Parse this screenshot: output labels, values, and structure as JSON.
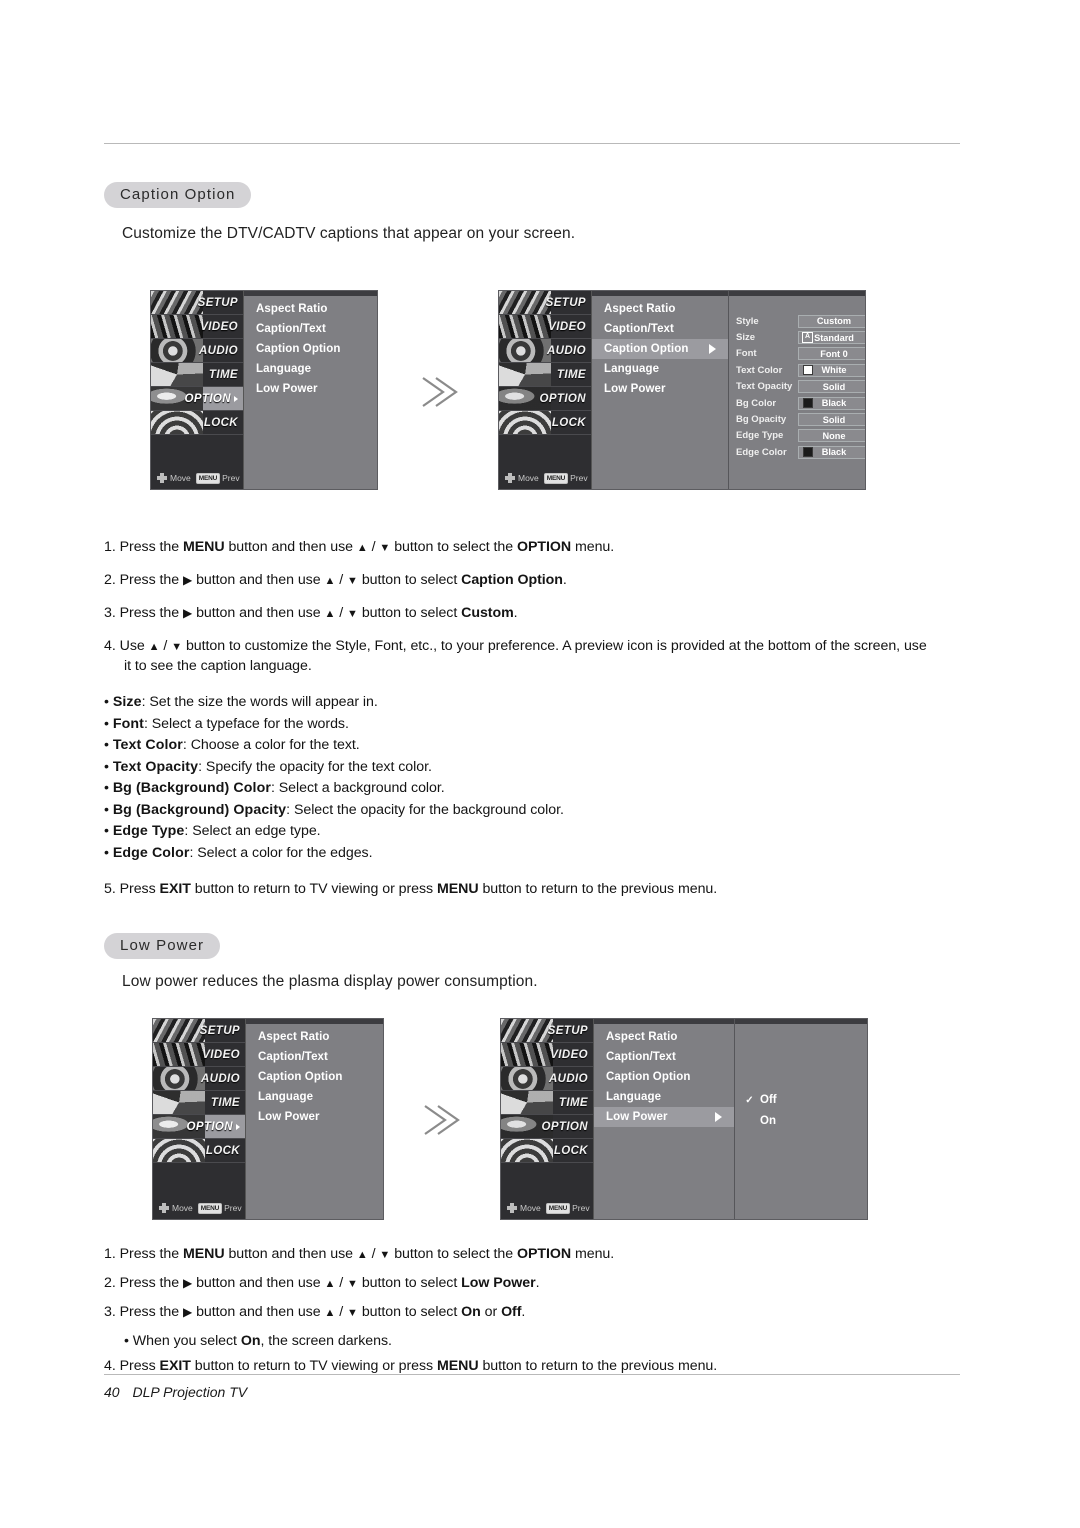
{
  "page": {
    "footer_page_number": "40",
    "footer_title": "DLP Projection TV"
  },
  "sections": [
    {
      "id": "caption_option",
      "heading": "Caption Option",
      "intro": "Customize the DTV/CADTV captions that appear on your screen."
    },
    {
      "id": "low_power",
      "heading": "Low Power",
      "intro": "Low power reduces the plasma display power consumption."
    }
  ],
  "osd": {
    "sidebar_items": [
      {
        "label": "SETUP"
      },
      {
        "label": "VIDEO"
      },
      {
        "label": "AUDIO"
      },
      {
        "label": "TIME"
      },
      {
        "label": "OPTION"
      },
      {
        "label": "LOCK"
      }
    ],
    "menu_items": [
      "Aspect Ratio",
      "Caption/Text",
      "Caption Option",
      "Language",
      "Low Power"
    ],
    "footbar": {
      "move_label": "Move",
      "prev_badge": "MENU",
      "prev_label": "Prev"
    },
    "caption_settings": [
      {
        "label": "Style",
        "value": "Custom",
        "swatch": "",
        "glyph": ""
      },
      {
        "label": "Size",
        "value": "Standard",
        "swatch": "",
        "glyph": "A"
      },
      {
        "label": "Font",
        "value": "Font  0",
        "swatch": "",
        "glyph": ""
      },
      {
        "label": "Text Color",
        "value": "White",
        "swatch": "#ffffff",
        "glyph": ""
      },
      {
        "label": "Text Opacity",
        "value": "Solid",
        "swatch": "",
        "glyph": ""
      },
      {
        "label": "Bg Color",
        "value": "Black",
        "swatch": "#1b1b1b",
        "glyph": ""
      },
      {
        "label": "Bg Opacity",
        "value": "Solid",
        "swatch": "",
        "glyph": ""
      },
      {
        "label": "Edge Type",
        "value": "None",
        "swatch": "",
        "glyph": ""
      },
      {
        "label": "Edge Color",
        "value": "Black",
        "swatch": "#1b1b1b",
        "glyph": ""
      }
    ],
    "low_power_choices": [
      {
        "label": "Off",
        "checked": true
      },
      {
        "label": "On",
        "checked": false
      }
    ]
  },
  "caption_steps": [
    "1. Press the <b>MENU</b> button and then use <span class=\"arrglyph\">▲</span> / <span class=\"arrglyph\">▼</span> button to select the <b>OPTION</b> menu.",
    "2. Press the <span class=\"rtri\">▶</span> button and then use <span class=\"arrglyph\">▲</span> / <span class=\"arrglyph\">▼</span> button to select <b>Caption Option</b>.",
    "3. Press the <span class=\"rtri\">▶</span> button and then use <span class=\"arrglyph\">▲</span> / <span class=\"arrglyph\">▼</span> button to select <b>Custom</b>.",
    "4. Use <span class=\"arrglyph\">▲</span> / <span class=\"arrglyph\">▼</span> button to customize the Style, Font, etc., to your preference. A preview icon is provided at the bottom of the screen, use<br><span class=\"step-sub\">it to see the caption language.</span>"
  ],
  "caption_bullets": [
    "• <b>Size</b>: Set the size the words will appear in.",
    "• <b>Font</b>: Select a typeface for the words.",
    "• <b>Text Color</b>: Choose a color for the text.",
    "• <b>Text Opacity</b>: Specify the opacity for the text color.",
    "• <b>Bg (Background) Color</b>: Select a background color.",
    "• <b>Bg (Background) Opacity</b>: Select the opacity for the background color.",
    "• <b>Edge Type</b>: Select an edge type.",
    "• <b>Edge Color</b>: Select a color for the edges."
  ],
  "caption_last_step": "5. Press <b>EXIT</b> button to return to TV viewing or press <b>MENU</b> button to return to the previous menu.",
  "lowpower_steps": [
    "1. Press the <b>MENU</b> button and then use <span class=\"arrglyph\">▲</span> / <span class=\"arrglyph\">▼</span> button to select the <b>OPTION</b> menu.",
    "2. Press the <span class=\"rtri\">▶</span> button and then use <span class=\"arrglyph\">▲</span> / <span class=\"arrglyph\">▼</span> button to select <b>Low Power</b>.",
    "3. Press the <span class=\"rtri\">▶</span> button and then use <span class=\"arrglyph\">▲</span> / <span class=\"arrglyph\">▼</span> button to select <b>On</b> or <b>Off</b>.",
    "<span class=\"step-sub\">• When you select <b>On</b>, the screen darkens.</span>",
    "4. Press <b>EXIT</b> button to return to TV viewing or press <b>MENU</b> button to return to the previous menu."
  ],
  "colors": {
    "osd_background": "#7f7f83",
    "osd_sidebar": "#2e2e31",
    "osd_highlight": "#9b9ba0",
    "pill_background": "#d4d3d6",
    "rule": "#b9b9b9"
  }
}
